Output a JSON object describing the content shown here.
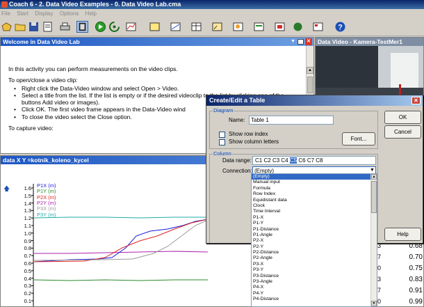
{
  "window": {
    "title": "Coach 6 - 2. Data Video Examples - 0. Data Video Lab.cma"
  },
  "menu": [
    "File",
    "Start",
    "Display",
    "Options",
    "Help"
  ],
  "welcome": {
    "title": "Welcome in Data Video Lab",
    "intro": "In this activity you can perform measurements on the video clips.",
    "open_heading": "To open/close a video clip:",
    "bullet1": "Right click the Data-Video window and select Open > Video.",
    "bullet2": "Select a title from the list. If the list is empty or if the desired videoclip to the list by clicking one of the buttons Add video or images).",
    "bullet3": "Click OK. The first video frame appears in the Data-Video wind",
    "bullet4": "To close the video select the Close option.",
    "capture_heading": "To capture video:"
  },
  "video": {
    "title": "Data Video - Kamera-TestMer1"
  },
  "graph": {
    "title": "data X Y =kotnik_koleno_kycel",
    "y_ticks": [
      "1.6",
      "1.5",
      "1.4",
      "1.3",
      "1.2",
      "1.1",
      "1.0",
      "0.9",
      "0.8",
      "0.7",
      "0.6",
      "0.5",
      "0.4",
      "0.3",
      "0.2",
      "0.1"
    ],
    "legend": [
      {
        "label": "P1X (m)",
        "color": "#1a1add"
      },
      {
        "label": "P1Y (m)",
        "color": "#2a8a2a"
      },
      {
        "label": "P2X (m)",
        "color": "#dd2222"
      },
      {
        "label": "P2Y (m)",
        "color": "#aa22aa"
      },
      {
        "label": "P3X (m)",
        "color": "#9a9a9a"
      },
      {
        "label": "P3Y (m)",
        "color": "#22aaaa"
      }
    ]
  },
  "table_values": {
    "left": [
      "3",
      "7",
      "0",
      "3",
      "7",
      "0"
    ],
    "right": [
      "0.68",
      "0.70",
      "0.75",
      "0.83",
      "0.91",
      "0.99"
    ]
  },
  "dialog": {
    "title": "Create/Edit a Table",
    "diagram_group": "Diagram",
    "name_label": "Name:",
    "name_value": "Table 1",
    "show_row_index": "Show row index",
    "show_column_letters": "Show column letters",
    "font_button": "Font...",
    "column_group": "Column",
    "data_range_label": "Data range:",
    "data_range_columns": [
      "C1",
      "C2",
      "C3",
      "C4",
      "C5",
      "C6",
      "C7",
      "C8"
    ],
    "data_range_selected": "C5",
    "connection_label": "Connection:",
    "connection_value": "(Empty)",
    "ok_button": "OK",
    "cancel_button": "Cancel",
    "help_button": "Help",
    "connection_options": [
      "(Empty)",
      "Manual input",
      "Formula",
      "Row Index",
      "Equidistant data",
      "Clock",
      "Time Interval",
      "P1-X",
      "P1-Y",
      "P1-Distance",
      "P1-Angle",
      "P2-X",
      "P2-Y",
      "P2-Distance",
      "P2-Angle",
      "P3-X",
      "P3-Y",
      "P3-Distance",
      "P3-Angle",
      "P4-X",
      "P4-Y",
      "P4-Distance"
    ]
  }
}
